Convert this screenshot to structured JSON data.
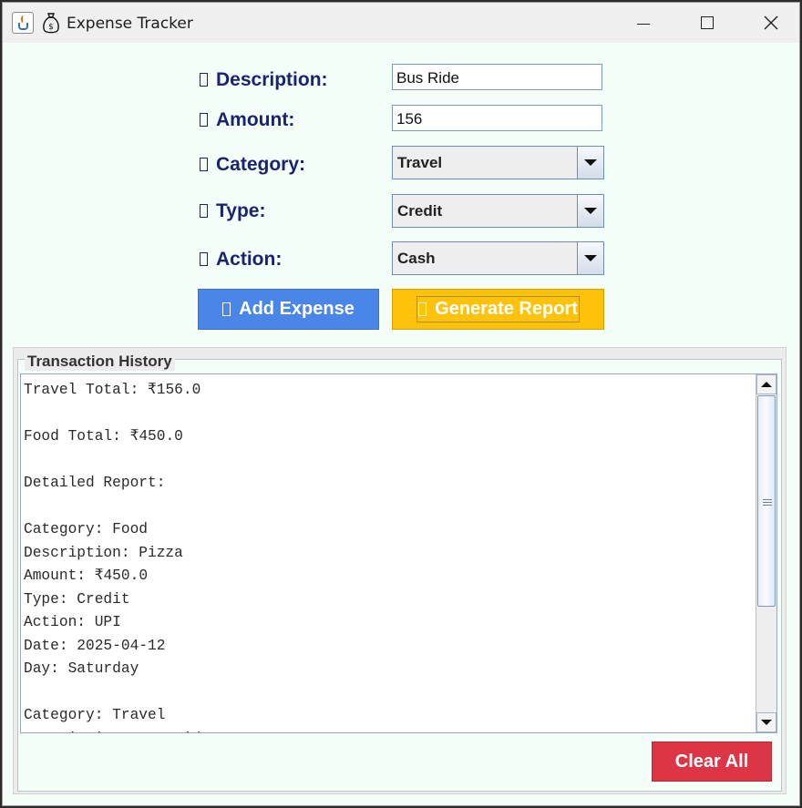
{
  "window": {
    "title": "Expense Tracker",
    "icons": [
      "java-cup-icon",
      "money-bag-icon"
    ],
    "controls": [
      "minimize-icon",
      "maximize-icon",
      "close-icon"
    ]
  },
  "form": {
    "description": {
      "label": "Description:",
      "value": "Bus Ride"
    },
    "amount": {
      "label": "Amount:",
      "value": "156"
    },
    "category": {
      "label": "Category:",
      "value": "Travel"
    },
    "type": {
      "label": "Type:",
      "value": "Credit"
    },
    "action": {
      "label": "Action:",
      "value": "Cash"
    }
  },
  "buttons": {
    "add": "Add Expense",
    "generate": "Generate Report",
    "clear": "Clear All"
  },
  "history": {
    "title": "Transaction History",
    "lines": [
      "Travel Total: ₹156.0",
      "",
      "Food Total: ₹450.0",
      "",
      "Detailed Report:",
      "",
      "Category: Food",
      "Description: Pizza",
      "Amount: ₹450.0",
      "Type: Credit",
      "Action: UPI",
      "Date: 2025-04-12",
      "Day: Saturday",
      "",
      "Category: Travel",
      "Description: Bus Ride"
    ]
  },
  "colors": {
    "window_bg": "#f4fffa",
    "label_text": "#1a2370",
    "add_button": "#4a86e8",
    "generate_button": "#fdc209",
    "clear_button": "#dc3545"
  }
}
